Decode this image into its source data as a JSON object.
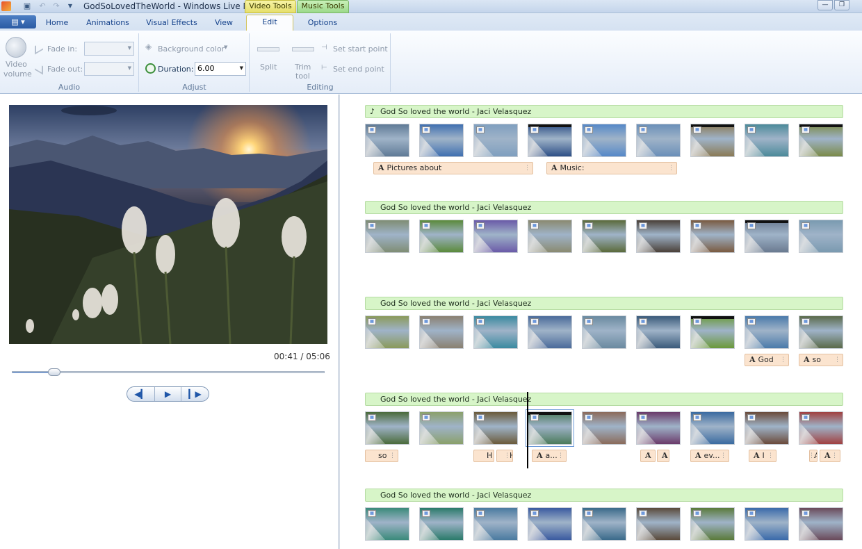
{
  "window": {
    "title": "GodSoLovedTheWorld - Windows Live M...",
    "context_tabs": [
      "Video Tools",
      "Music Tools"
    ],
    "controls": [
      "—",
      "❐"
    ]
  },
  "tabs": [
    {
      "label": "Home"
    },
    {
      "label": "Animations"
    },
    {
      "label": "Visual Effects"
    },
    {
      "label": "View"
    },
    {
      "label": "Edit"
    },
    {
      "label": "Options"
    }
  ],
  "ribbon": {
    "audio": {
      "label": "Audio",
      "video_volume": "Video\nvolume",
      "video_volume_1": "Video",
      "video_volume_2": "volume",
      "fade_in": "Fade in:",
      "fade_out": "Fade out:"
    },
    "adjust": {
      "label": "Adjust",
      "background_color": "Background color",
      "duration_label": "Duration:",
      "duration_value": "6.00"
    },
    "editing": {
      "label": "Editing",
      "split": "Split",
      "trim_1": "Trim",
      "trim_2": "tool",
      "set_start": "Set start point",
      "set_end": "Set end point"
    }
  },
  "preview": {
    "time": "00:41 / 05:06",
    "progress": 0.134
  },
  "storyboard": {
    "music_title": "God So loved the world - Jaci Velasquez",
    "row1_captions": [
      "Pictures about",
      "Music:"
    ],
    "row3_captions": [
      "God",
      "so"
    ],
    "row4_captions": [
      "so",
      "H",
      "H",
      "a...",
      "",
      "",
      "ev...",
      "I",
      "",
      ""
    ]
  },
  "colors": {
    "ribbon_text": "#1e395b",
    "music_bar": "#d7f5c8",
    "caption": "#fbe4cf",
    "video_tools": "#e6df6a",
    "music_tools": "#9bd98a"
  }
}
